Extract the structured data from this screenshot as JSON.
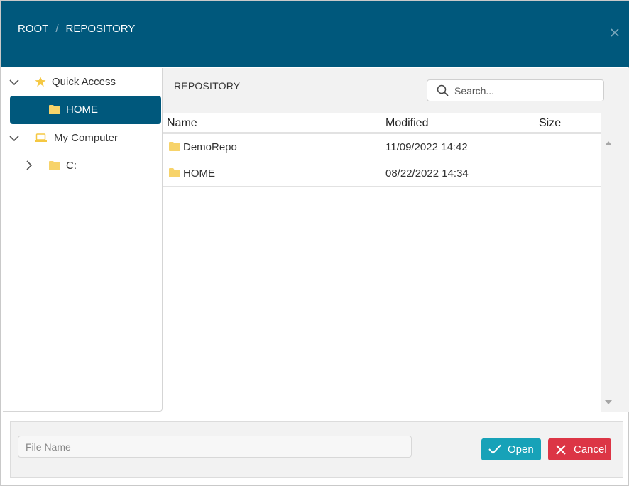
{
  "header": {
    "breadcrumb": [
      {
        "label": "ROOT"
      },
      {
        "label": "REPOSITORY"
      }
    ],
    "close_icon": "close-icon"
  },
  "tree": {
    "items": [
      {
        "label": "Quick Access",
        "icon": "star-icon",
        "expanded": true
      },
      {
        "label": "HOME",
        "icon": "folder-icon",
        "selected": true
      },
      {
        "label": "My Computer",
        "icon": "laptop-icon",
        "expanded": true
      },
      {
        "label": "C:",
        "icon": "folder-icon",
        "expanded": false
      }
    ]
  },
  "content": {
    "title": "REPOSITORY",
    "search": {
      "placeholder": "Search..."
    },
    "columns": [
      "Name",
      "Modified",
      "Size"
    ],
    "rows": [
      {
        "name": "DemoRepo",
        "modified": "11/09/2022 14:42",
        "size": ""
      },
      {
        "name": "HOME",
        "modified": "08/22/2022 14:34",
        "size": ""
      }
    ]
  },
  "footer": {
    "file_name": {
      "placeholder": "File Name",
      "value": ""
    },
    "open_label": "Open",
    "cancel_label": "Cancel"
  },
  "colors": {
    "header": "#00587c",
    "selected": "#00587c",
    "open": "#17a2b8",
    "cancel": "#dc3545",
    "folder": "#f7d36a",
    "star": "#f5c842"
  }
}
